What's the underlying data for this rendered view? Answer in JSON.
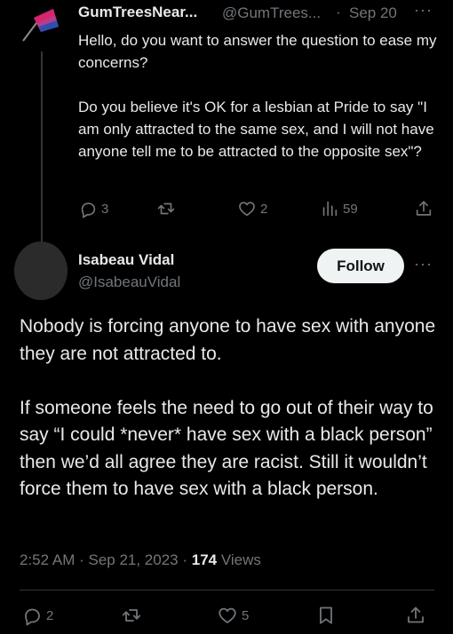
{
  "parent_tweet": {
    "display_name": "GumTreesNear...",
    "handle": "@GumTrees...",
    "separator": "·",
    "date": "Sep 20",
    "more": "···",
    "paragraphs": [
      "Hello, do you want to answer the question to ease my concerns?",
      "Do you believe it's OK for a lesbian at Pride to say \"I am only attracted to the same sex, and I will not have anyone tell me to be attracted to the opposite sex\"?"
    ],
    "actions": {
      "replies": "3",
      "retweets": "",
      "likes": "2",
      "views": "59"
    }
  },
  "main_tweet": {
    "display_name": "Isabeau Vidal",
    "handle": "@IsabeauVidal",
    "follow_label": "Follow",
    "more": "···",
    "paragraphs": [
      "Nobody is forcing anyone to have sex with anyone they are not attracted to.",
      "If someone feels the need to go out of their way to say “I could *never* have sex with a black person” then we’d all agree they are racist. Still it wouldn’t force them to have sex with a black person."
    ],
    "meta": {
      "time": "2:52 AM",
      "separator": " · ",
      "date": "Sep 21, 2023",
      "views_count": "174",
      "views_label": "Views"
    },
    "actions": {
      "replies": "2",
      "likes": "5"
    }
  },
  "colors": {
    "background": "#000000",
    "text": "#e7e9ea",
    "muted": "#71767b",
    "follow_bg": "#eff3f4"
  }
}
